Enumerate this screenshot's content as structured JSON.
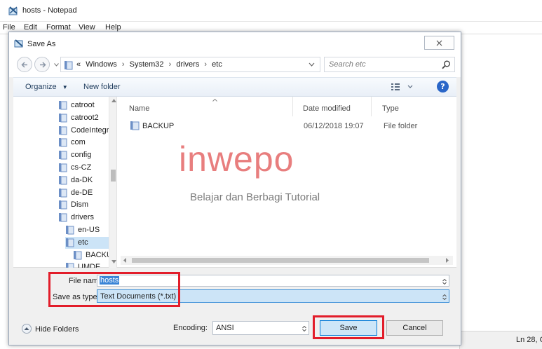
{
  "notepad": {
    "title": "hosts - Notepad",
    "menu": [
      "File",
      "Edit",
      "Format",
      "View",
      "Help"
    ],
    "status": "Ln 28, C"
  },
  "dialog": {
    "title": "Save As",
    "breadcrumb": [
      "«",
      "Windows",
      "System32",
      "drivers",
      "etc"
    ],
    "search_placeholder": "Search etc",
    "toolbar": {
      "organize": "Organize",
      "new_folder": "New folder",
      "help": "?"
    },
    "tree": [
      "catroot",
      "catroot2",
      "CodeIntegr",
      "com",
      "config",
      "cs-CZ",
      "da-DK",
      "de-DE",
      "Dism",
      "drivers",
      "en-US",
      "etc",
      "BACKUF",
      "UMDF"
    ],
    "columns": {
      "name": "Name",
      "date": "Date modified",
      "type": "Type"
    },
    "files": [
      {
        "name": "BACKUP",
        "date": "06/12/2018 19:07",
        "type": "File folder"
      }
    ],
    "file_name_label": "File name:",
    "file_name_value": "hosts",
    "save_type_label": "Save as type:",
    "save_type_value": "Text Documents (*.txt)",
    "hide_folders": "Hide Folders",
    "encoding_label": "Encoding:",
    "encoding_value": "ANSI",
    "save": "Save",
    "cancel": "Cancel"
  },
  "watermark": {
    "title": "inwepo",
    "subtitle": "Belajar dan Berbagi Tutorial"
  },
  "colors": {
    "highlight_red": "#e21d2a",
    "selection_blue": "#cce4f7",
    "accent_blue": "#0078d7",
    "folder_yellow": "#e8c35a"
  }
}
